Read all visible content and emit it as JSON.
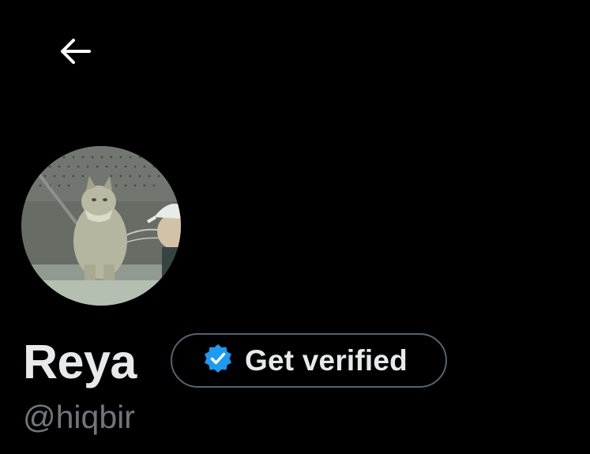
{
  "header": {
    "back_icon": "arrow-left-icon"
  },
  "profile": {
    "display_name": "Reya",
    "handle": "@hiqbir",
    "avatar_description_icon": "profile-photo"
  },
  "verify": {
    "label": "Get verified",
    "icon": "verified-badge-icon",
    "badge_color": "#1d9bf0"
  },
  "colors": {
    "background": "#000000",
    "primary_text": "#e7e9ea",
    "secondary_text": "#71767b",
    "border": "#536471"
  }
}
